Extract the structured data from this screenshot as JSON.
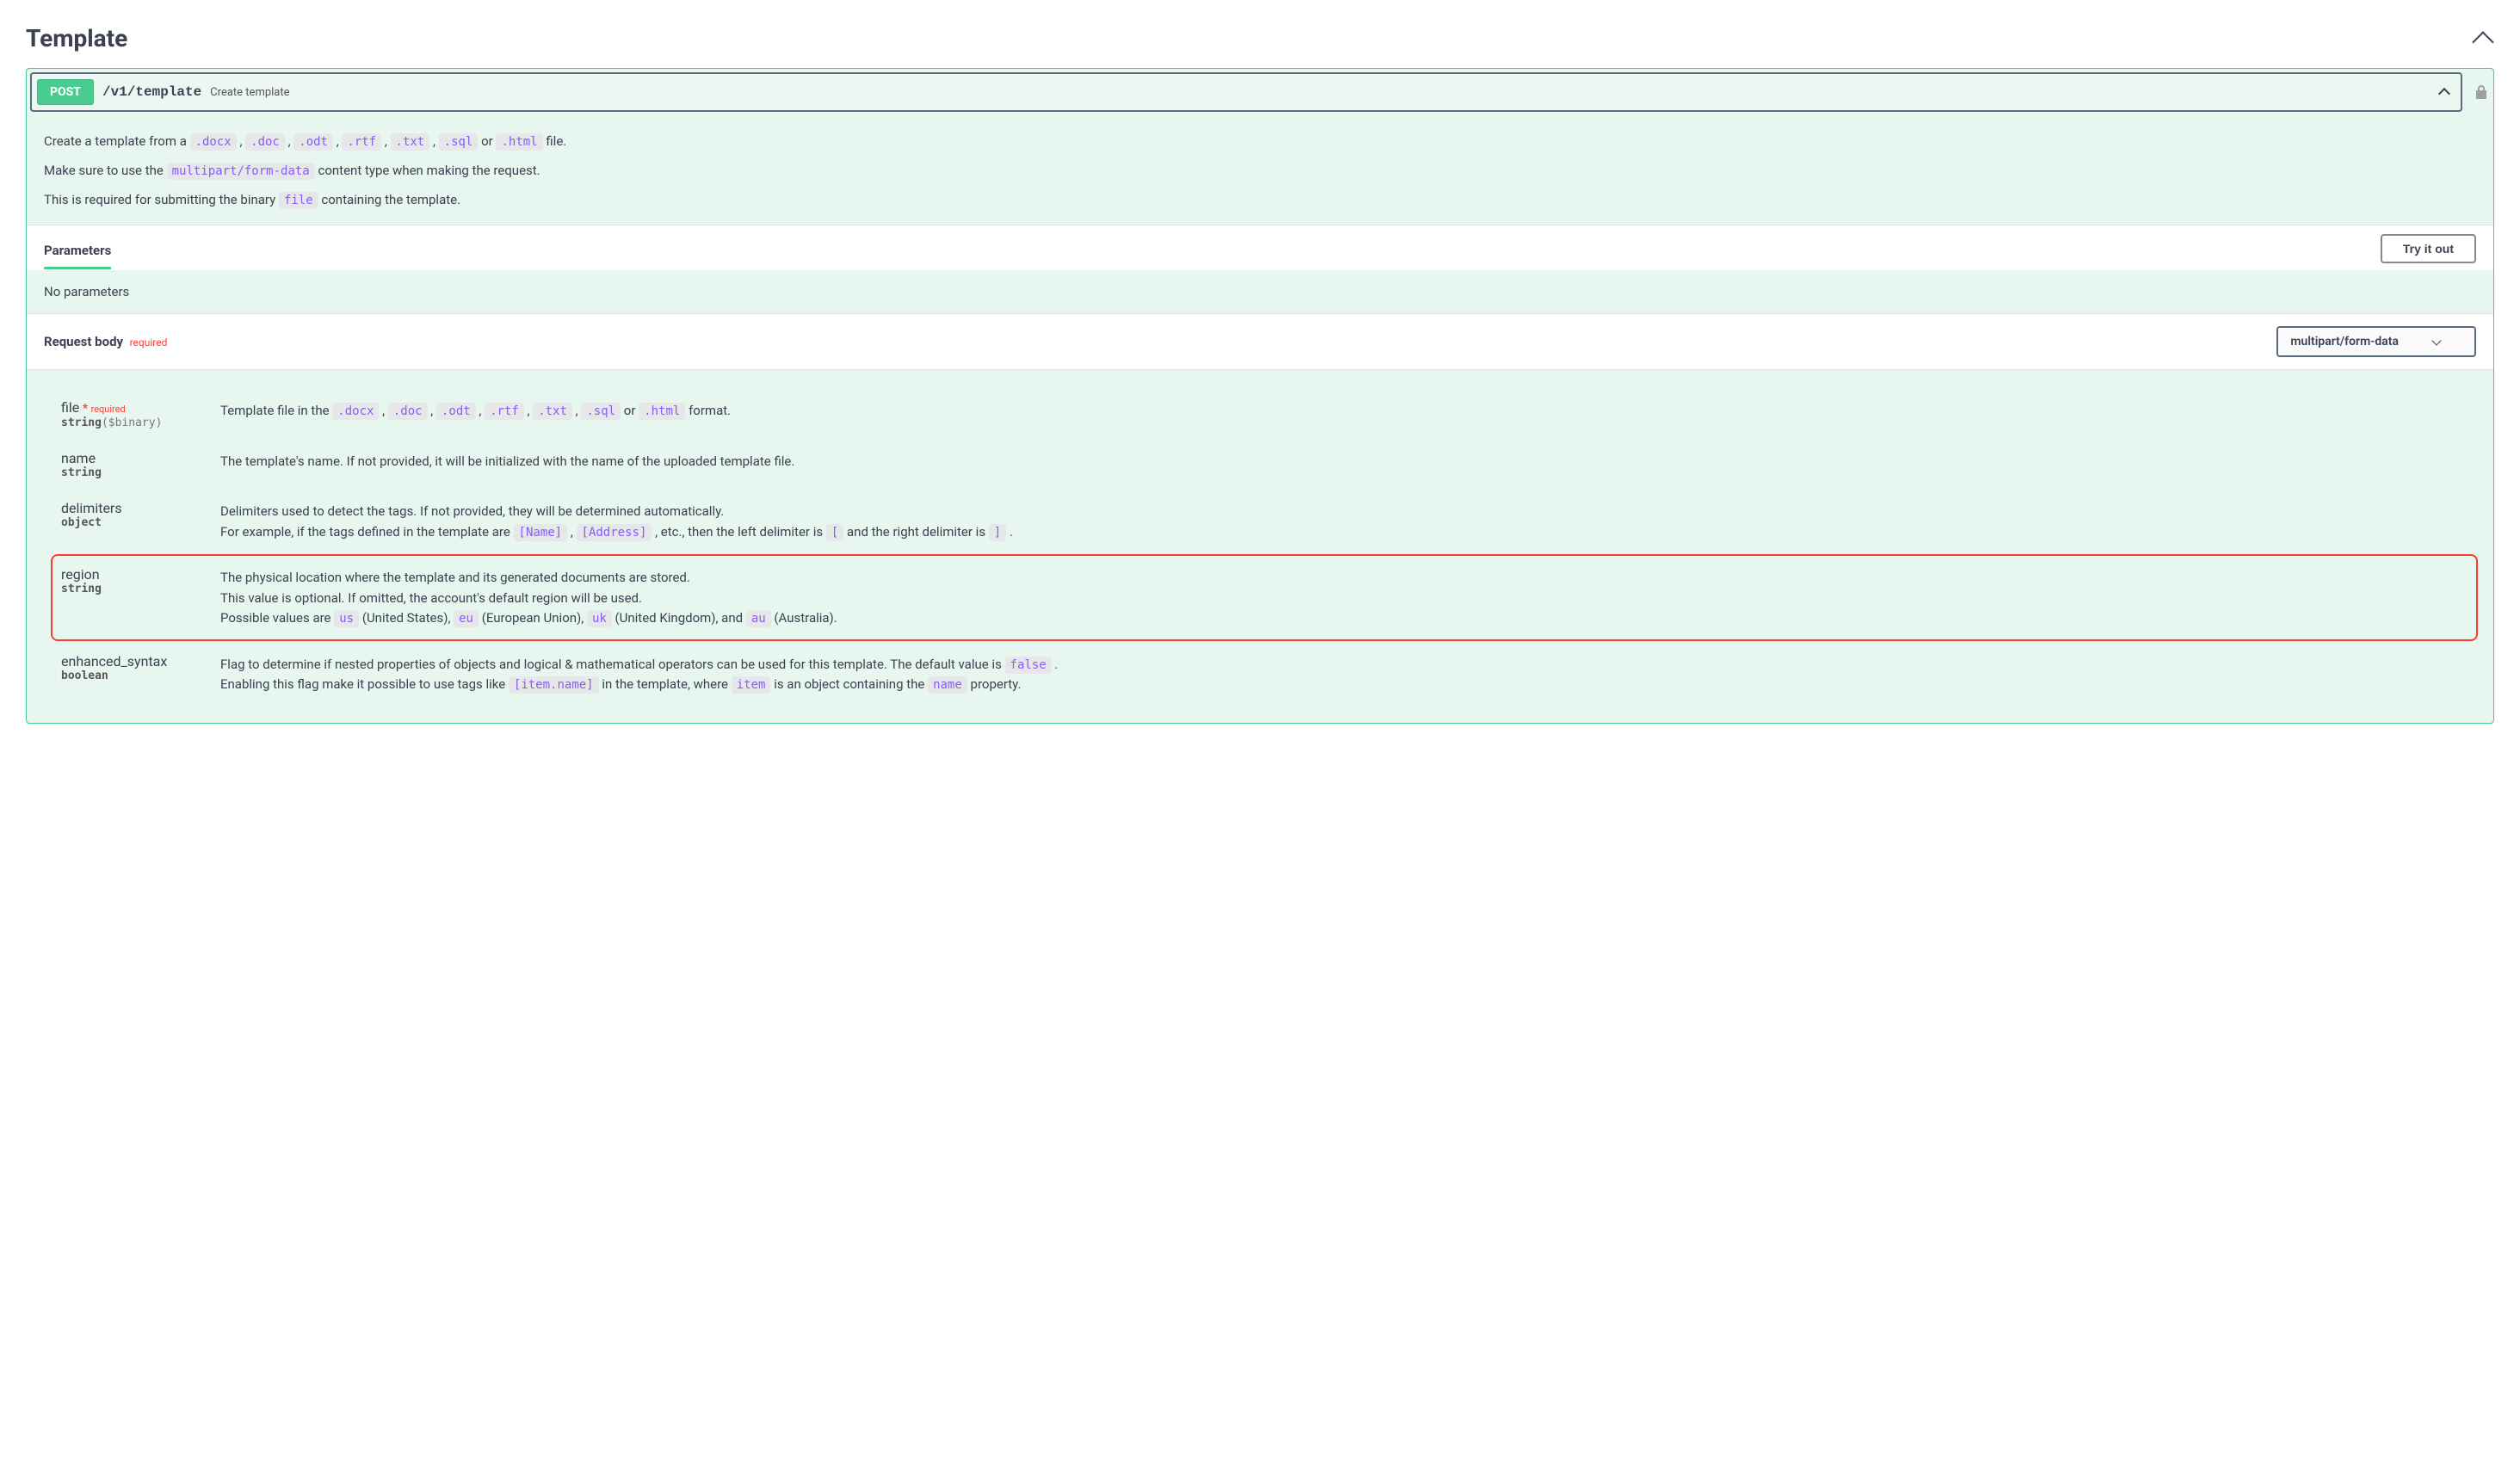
{
  "section": {
    "title": "Template"
  },
  "opblock": {
    "method": "POST",
    "path": "/v1/template",
    "summary": "Create template"
  },
  "description": {
    "line1_prefix": "Create a template from a ",
    "extensions": [
      ".docx",
      ".doc",
      ".odt",
      ".rtf",
      ".txt",
      ".sql"
    ],
    "or_word": "or",
    "html_ext": ".html",
    "line1_suffix": " file.",
    "line2_prefix": "Make sure to use the ",
    "multipart": "multipart/form-data",
    "line2_suffix": " content type when making the request.",
    "line3_prefix": "This is required for submitting the binary ",
    "file_word": "file",
    "line3_suffix": " containing the template."
  },
  "parameters": {
    "tab_label": "Parameters",
    "try_button": "Try it out",
    "no_params": "No parameters"
  },
  "request_body": {
    "label": "Request body",
    "required": "required",
    "content_type": "multipart/form-data"
  },
  "fields": {
    "file": {
      "name": "file",
      "required": "required",
      "type": "string",
      "format": "($binary)",
      "desc_prefix": "Template file in the ",
      "extensions": [
        ".docx",
        ".doc",
        ".odt",
        ".rtf",
        ".txt",
        ".sql"
      ],
      "or_word": "or",
      "html_ext": ".html",
      "desc_suffix": " format."
    },
    "name": {
      "name": "name",
      "type": "string",
      "desc": "The template's name. If not provided, it will be initialized with the name of the uploaded template file."
    },
    "delimiters": {
      "name": "delimiters",
      "type": "object",
      "desc_line1": "Delimiters used to detect the tags. If not provided, they will be determined automatically.",
      "desc_line2_prefix": "For example, if the tags defined in the template are ",
      "tag1": "[Name]",
      "tag2": "[Address]",
      "mid1": " , etc., then the left delimiter is ",
      "left_delim": "[",
      "mid2": " and the right delimiter is ",
      "right_delim": "]",
      "suffix": " ."
    },
    "region": {
      "name": "region",
      "type": "string",
      "line1": "The physical location where the template and its generated documents are stored.",
      "line2": "This value is optional. If omitted, the account's default region will be used.",
      "line3_prefix": "Possible values are ",
      "us": "us",
      "us_label": " (United States), ",
      "eu": "eu",
      "eu_label": " (European Union), ",
      "uk": "uk",
      "uk_label": " (United Kingdom), and ",
      "au": "au",
      "au_label": " (Australia)."
    },
    "enhanced_syntax": {
      "name": "enhanced_syntax",
      "type": "boolean",
      "line1_prefix": "Flag to determine if nested properties of objects and logical & mathematical operators can be used for this template. The default value is ",
      "false_token": "false",
      "line1_suffix": " .",
      "line2_prefix": "Enabling this flag make it possible to use tags like ",
      "item_name": "[item.name]",
      "mid1": " in the template, where ",
      "item_token": "item",
      "mid2": " is an object containing the ",
      "name_token": "name",
      "line2_suffix": " property."
    }
  }
}
